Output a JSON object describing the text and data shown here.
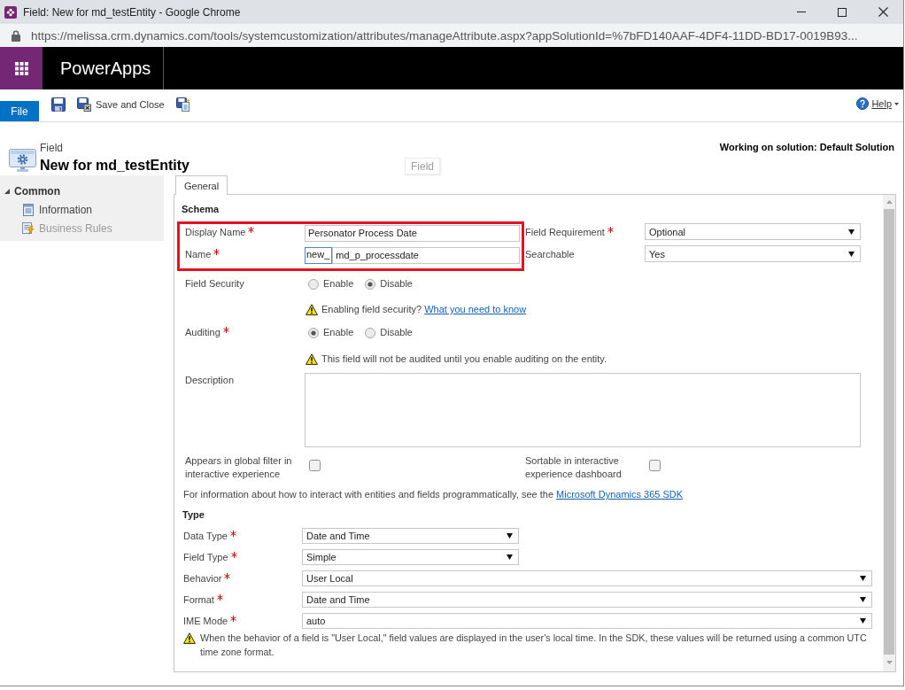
{
  "browser": {
    "title": "Field: New for md_testEntity - Google Chrome",
    "url": "https://melissa.crm.dynamics.com/tools/systemcustomization/attributes/manageAttribute.aspx?appSolutionId=%7bFD140AAF-4DF4-11DD-BD17-0019B93..."
  },
  "app_bar": {
    "title": "PowerApps"
  },
  "command_bar": {
    "file_tab": "File",
    "commands": [
      {
        "kind": "save"
      },
      {
        "kind": "save_close",
        "label": "Save and Close"
      },
      {
        "kind": "save_new"
      }
    ],
    "help": "Help"
  },
  "header": {
    "entity_type": "Field",
    "title": "New for md_testEntity",
    "ghost_label": "Field",
    "solution": "Working on solution: Default Solution"
  },
  "nav": {
    "section": "Common",
    "expanded": true,
    "items": [
      {
        "kind": "info",
        "label": "Information",
        "disabled": false
      },
      {
        "kind": "rules",
        "label": "Business Rules",
        "disabled": true
      }
    ]
  },
  "tabs": [
    {
      "label": "General",
      "selected": true
    }
  ],
  "schema": {
    "heading": "Schema",
    "highlighted": true,
    "name_fields": [
      {
        "label": "Display Name",
        "required": true,
        "value": "Personator Process Date"
      },
      {
        "label": "Name",
        "required": true,
        "prefix": "new_",
        "value": "md_p_processdate"
      }
    ],
    "side_fields": [
      {
        "label": "Field Requirement",
        "required": true,
        "value": "Optional"
      },
      {
        "label": "Searchable",
        "required": false,
        "value": "Yes"
      }
    ],
    "field_security": {
      "label": "Field Security",
      "required": false,
      "options": [
        {
          "label": "Enable",
          "selected": false
        },
        {
          "label": "Disable",
          "selected": true
        }
      ],
      "note": "Enabling field security?",
      "link": "What you need to know"
    },
    "auditing": {
      "label": "Auditing",
      "required": true,
      "options": [
        {
          "label": "Enable",
          "selected": true
        },
        {
          "label": "Disable",
          "selected": false
        }
      ],
      "note": "This field will not be audited until you enable auditing on the entity."
    },
    "description": {
      "label": "Description"
    },
    "global_filter": {
      "label": "Appears in global filter in interactive experience",
      "checked": false
    },
    "sortable": {
      "label": "Sortable in interactive experience dashboard",
      "checked": false
    },
    "sdk_note": {
      "text": "For information about how to interact with entities and fields programmatically, see the",
      "link": "Microsoft Dynamics 365 SDK"
    }
  },
  "type": {
    "heading": "Type",
    "narrow_fields": [
      {
        "label": "Data Type",
        "required": true,
        "value": "Date and Time"
      },
      {
        "label": "Field Type",
        "required": true,
        "value": "Simple"
      }
    ],
    "wide_fields": [
      {
        "label": "Behavior",
        "required": true,
        "value": "User Local"
      },
      {
        "label": "Format",
        "required": true,
        "value": "Date and Time"
      },
      {
        "label": "IME Mode",
        "required": true,
        "value": "auto"
      }
    ],
    "note": "When the behavior of a field is \"User Local,\" field values are displayed in the user's local time. In the SDK, these values will be returned using a common UTC time zone format."
  }
}
